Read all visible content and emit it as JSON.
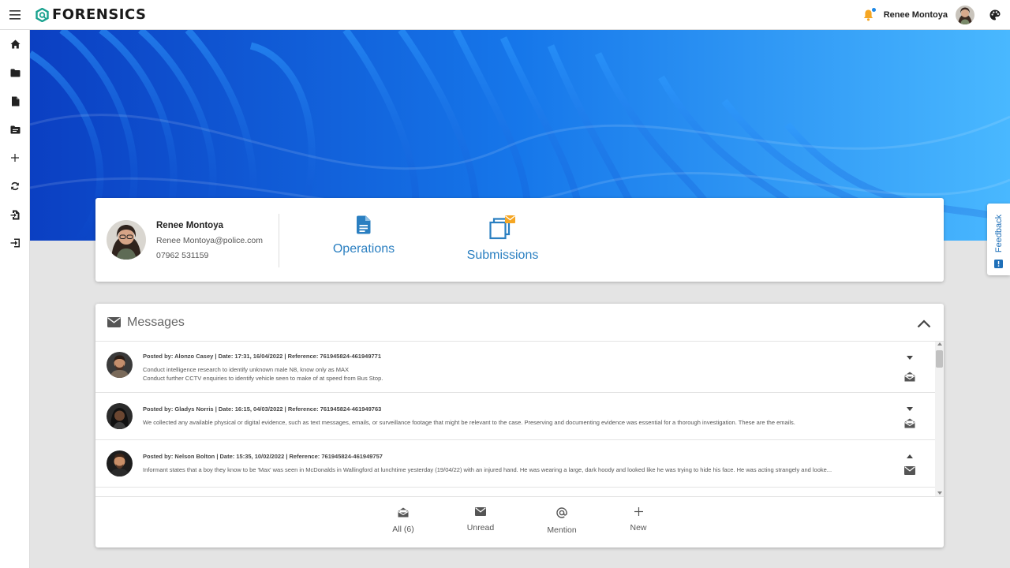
{
  "app": {
    "brand": "FORENSICS",
    "brand_color": "#1aa28f",
    "accent": "#2a7fc1"
  },
  "topbar": {
    "user_name": "Renee Montoya",
    "icons": [
      "menu-icon",
      "bell-icon",
      "palette-icon"
    ]
  },
  "sidebar": {
    "items": [
      {
        "icon": "home-icon"
      },
      {
        "icon": "folder-icon"
      },
      {
        "icon": "document-icon"
      },
      {
        "icon": "folder-list-icon"
      },
      {
        "icon": "plus-icon"
      },
      {
        "icon": "sync-icon"
      },
      {
        "icon": "file-import-icon"
      },
      {
        "icon": "sign-out-icon"
      }
    ]
  },
  "profile": {
    "name": "Renee Montoya",
    "email": "Renee Montoya@police.com",
    "phone": "07962 531159",
    "actions": [
      {
        "label": "Operations",
        "icon": "document-icon"
      },
      {
        "label": "Submissions",
        "icon": "submissions-icon"
      }
    ]
  },
  "messages": {
    "title": "Messages",
    "items": [
      {
        "meta": "Posted by: Alonzo Casey | Date: 17:31, 16/04/2022 | Reference: 761945824-461949771",
        "lines": [
          "Conduct intelligence research to identify unknown male N8, know only as MAX",
          "Conduct further CCTV enquiries to identify vehicle seen to make of at speed from Bus Stop."
        ],
        "read": true
      },
      {
        "meta": "Posted by: Gladys Norris | Date: 16:15, 04/03/2022 | Reference: 761945824-461949763",
        "lines": [
          "We collected any available physical or digital evidence, such as text messages, emails, or surveillance footage that might be relevant to the case. Preserving and documenting evidence was essential for a thorough investigation. These are the emails."
        ],
        "read": true
      },
      {
        "meta": "Posted by: Nelson Bolton | Date: 15:35, 10/02/2022 | Reference: 761945824-461949757",
        "lines": [
          "Informant states that a boy they know to be 'Max' was seen in McDonalds in Wallingford at lunchtime yesterday (19/04/22) with an injured hand. He was wearing a large, dark hoody and looked like he was trying to hide his face. He was acting strangely and looke..."
        ],
        "read": false
      }
    ],
    "footer": [
      {
        "label": "All (6)",
        "icon": "mail-open-icon"
      },
      {
        "label": "Unread",
        "icon": "mail-icon"
      },
      {
        "label": "Mention",
        "icon": "at-icon"
      },
      {
        "label": "New",
        "icon": "plus-icon"
      }
    ]
  },
  "feedback": {
    "label": "Feedback"
  }
}
